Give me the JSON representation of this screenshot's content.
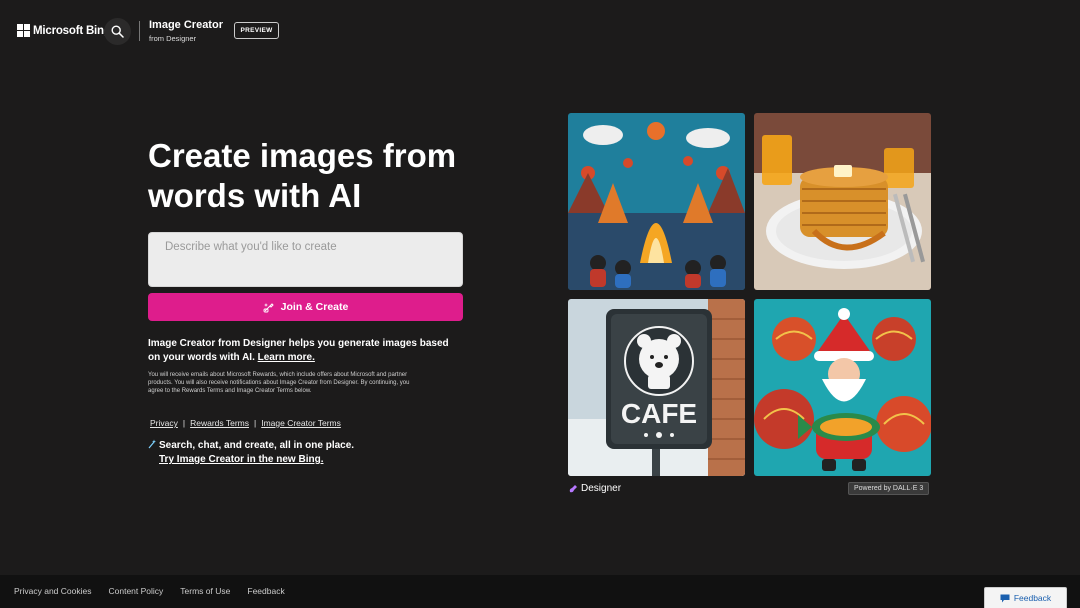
{
  "header": {
    "brand": "Microsoft Bing",
    "product_title": "Image Creator",
    "product_subtitle": "from Designer",
    "badge": "PREVIEW"
  },
  "hero": {
    "title": "Create images from words with AI",
    "prompt_placeholder": "Describe what you'd like to create",
    "join_button": "Join & Create",
    "description": "Image Creator from Designer helps you generate images based on your words with AI.",
    "learn_more": "Learn more.",
    "fine_print": "You will receive emails about Microsoft Rewards, which include offers about Microsoft and partner products. You will also receive notifications about Image Creator from Designer. By continuing, you agree to the Rewards Terms and Image Creator Terms below."
  },
  "legal_links": {
    "privacy": "Privacy",
    "sep1": "|",
    "rewards_terms": "Rewards Terms",
    "sep2": "|",
    "image_creator_terms": "Image Creator Terms"
  },
  "promo": {
    "line1": "Search, chat, and create, all in one place.",
    "line2": "Try Image Creator in the new Bing."
  },
  "gallery": {
    "images": [
      "felt-bonfire-scene",
      "pancakes-with-orange-juice",
      "polar-bear-cafe-sign",
      "santa-with-ornaments-and-fish"
    ],
    "designer_label": "Designer",
    "powered_by": "Powered by DALL·E 3",
    "cafe_sign_text": "CAFE"
  },
  "footer": {
    "links": [
      "Privacy and Cookies",
      "Content Policy",
      "Terms of Use",
      "Feedback"
    ],
    "feedback_button": "Feedback"
  },
  "colors": {
    "background": "#1c1b1b",
    "accent": "#de1d8c",
    "footer": "#111111"
  }
}
